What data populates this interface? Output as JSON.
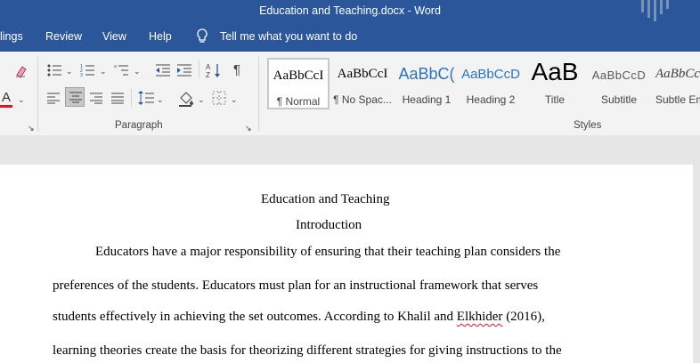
{
  "window": {
    "title": "Education and Teaching.docx  -  Word"
  },
  "menu": {
    "items": [
      "lings",
      "Review",
      "View",
      "Help"
    ],
    "tell_me": "Tell me what you want to do"
  },
  "ribbon": {
    "paragraph_label": "Paragraph",
    "styles_label": "Styles",
    "styles": [
      {
        "sample": "AaBbCcI",
        "name": "¶ Normal"
      },
      {
        "sample": "AaBbCcI",
        "name": "¶ No Spac..."
      },
      {
        "sample": "AaBbC(",
        "name": "Heading 1"
      },
      {
        "sample": "AaBbCcD",
        "name": "Heading 2"
      },
      {
        "sample": "AaB",
        "name": "Title"
      },
      {
        "sample": "AaBbCcD",
        "name": "Subtitle"
      },
      {
        "sample": "AaBbCcI",
        "name": "Subtle Em"
      }
    ],
    "colors": {
      "accent": "#2b579a",
      "font_color_bar": "#e81123",
      "heading": "#2e74b5"
    }
  },
  "document": {
    "title": "Education and Teaching",
    "heading": "Introduction",
    "lines": [
      "Educators have a major responsibility of ensuring that their teaching plan considers the",
      "preferences of the students. Educators must plan for an instructional framework that serves",
      "students effectively in achieving the set outcomes. According to Khalil and ",
      "learning theories create the basis for theorizing different strategies for giving instructions to the"
    ],
    "misspelled": "Elkhider",
    "line3_tail": " (2016),"
  }
}
